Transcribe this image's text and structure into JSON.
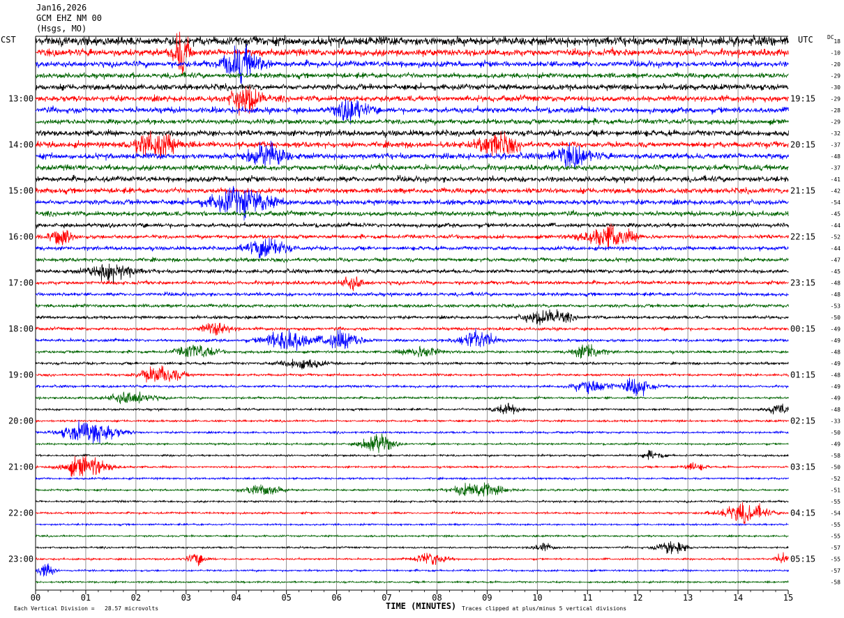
{
  "chart_data": {
    "type": "line",
    "title_lines": [
      "Jan16,2026",
      "GCM EHZ NM 00",
      "(Hsgs, MO)"
    ],
    "left_axis_label": "CST",
    "right_axis_label": "UTC",
    "dc_label": "DC",
    "xlabel": "TIME (MINUTES)",
    "x_ticks": [
      "00",
      "01",
      "02",
      "03",
      "04",
      "05",
      "06",
      "07",
      "08",
      "09",
      "10",
      "11",
      "12",
      "13",
      "14",
      "15"
    ],
    "xlim": [
      0,
      15
    ],
    "trace_colors": [
      "#000000",
      "#ff0000",
      "#0000ff",
      "#006400"
    ],
    "trace_count": 48,
    "traces_per_hour": 4,
    "left_hour_labels": [
      "13:00",
      "14:00",
      "15:00",
      "16:00",
      "17:00",
      "18:00",
      "19:00",
      "20:00",
      "21:00",
      "22:00",
      "23:00"
    ],
    "left_hour_trace_index": [
      5,
      9,
      13,
      17,
      21,
      25,
      29,
      33,
      37,
      41,
      45
    ],
    "right_hour_labels": [
      "19:15",
      "20:15",
      "21:15",
      "22:15",
      "23:15",
      "00:15",
      "01:15",
      "02:15",
      "03:15",
      "04:15",
      "05:15"
    ],
    "dc_values": [
      "18",
      "-10",
      "-20",
      "-29",
      "-30",
      "-29",
      "-28",
      "-29",
      "-32",
      "-37",
      "-48",
      "-37",
      "-41",
      "-42",
      "-54",
      "-45",
      "-44",
      "-52",
      "-44",
      "-47",
      "-45",
      "-48",
      "-48",
      "-53",
      "-50",
      "-49",
      "-49",
      "-48",
      "-49",
      "-48",
      "-49",
      "-49",
      "-48",
      "-33",
      "-50",
      "-49",
      "-58",
      "-50",
      "-52",
      "-51",
      "-55",
      "-54",
      "-55",
      "-55",
      "-57",
      "-55",
      "-57",
      "-58"
    ],
    "trace_amplitude": [
      7.0,
      5.4,
      4.6,
      4.1,
      4.6,
      4.6,
      4.5,
      4.0,
      4.6,
      4.6,
      4.5,
      4.4,
      4.3,
      4.2,
      4.0,
      3.8,
      3.3,
      3.0,
      3.0,
      3.0,
      3.0,
      2.8,
      2.7,
      2.6,
      2.4,
      2.3,
      2.2,
      2.0,
      2.0,
      1.8,
      1.8,
      1.7,
      1.6,
      1.6,
      1.6,
      1.5,
      1.5,
      1.5,
      1.5,
      1.5,
      1.5,
      1.5,
      1.4,
      1.4,
      1.4,
      1.4,
      1.4,
      1.4
    ],
    "events": [
      {
        "trace": 1,
        "minute": 2.9,
        "amplitude": 40,
        "width_min": 0.2
      },
      {
        "trace": 2,
        "minute": 4.1,
        "amplitude": 25,
        "width_min": 0.5
      },
      {
        "trace": 5,
        "minute": 4.2,
        "amplitude": 22,
        "width_min": 0.4
      },
      {
        "trace": 6,
        "minute": 6.3,
        "amplitude": 20,
        "width_min": 0.4
      },
      {
        "trace": 9,
        "minute": 2.4,
        "amplitude": 18,
        "width_min": 0.6
      },
      {
        "trace": 9,
        "minute": 9.2,
        "amplitude": 18,
        "width_min": 0.5
      },
      {
        "trace": 10,
        "minute": 4.6,
        "amplitude": 20,
        "width_min": 0.5
      },
      {
        "trace": 10,
        "minute": 10.7,
        "amplitude": 16,
        "width_min": 0.5
      },
      {
        "trace": 14,
        "minute": 4.1,
        "amplitude": 22,
        "width_min": 0.8
      },
      {
        "trace": 17,
        "minute": 0.5,
        "amplitude": 14,
        "width_min": 0.3
      },
      {
        "trace": 17,
        "minute": 11.4,
        "amplitude": 16,
        "width_min": 0.7
      },
      {
        "trace": 18,
        "minute": 4.6,
        "amplitude": 18,
        "width_min": 0.5
      },
      {
        "trace": 20,
        "minute": 1.5,
        "amplitude": 14,
        "width_min": 0.6
      },
      {
        "trace": 21,
        "minute": 6.3,
        "amplitude": 10,
        "width_min": 0.3
      },
      {
        "trace": 24,
        "minute": 10.2,
        "amplitude": 12,
        "width_min": 0.6
      },
      {
        "trace": 25,
        "minute": 3.6,
        "amplitude": 10,
        "width_min": 0.4
      },
      {
        "trace": 26,
        "minute": 5.0,
        "amplitude": 18,
        "width_min": 0.6
      },
      {
        "trace": 26,
        "minute": 6.1,
        "amplitude": 16,
        "width_min": 0.5
      },
      {
        "trace": 26,
        "minute": 8.8,
        "amplitude": 16,
        "width_min": 0.5
      },
      {
        "trace": 27,
        "minute": 3.2,
        "amplitude": 12,
        "width_min": 0.5
      },
      {
        "trace": 27,
        "minute": 7.7,
        "amplitude": 10,
        "width_min": 0.5
      },
      {
        "trace": 27,
        "minute": 11.0,
        "amplitude": 12,
        "width_min": 0.4
      },
      {
        "trace": 28,
        "minute": 5.3,
        "amplitude": 10,
        "width_min": 0.5
      },
      {
        "trace": 29,
        "minute": 2.5,
        "amplitude": 14,
        "width_min": 0.6
      },
      {
        "trace": 30,
        "minute": 11.1,
        "amplitude": 12,
        "width_min": 0.5
      },
      {
        "trace": 30,
        "minute": 12.0,
        "amplitude": 14,
        "width_min": 0.4
      },
      {
        "trace": 31,
        "minute": 1.9,
        "amplitude": 10,
        "width_min": 0.6
      },
      {
        "trace": 32,
        "minute": 9.4,
        "amplitude": 8,
        "width_min": 0.4
      },
      {
        "trace": 32,
        "minute": 14.8,
        "amplitude": 8,
        "width_min": 0.3
      },
      {
        "trace": 34,
        "minute": 1.1,
        "amplitude": 20,
        "width_min": 0.7
      },
      {
        "trace": 35,
        "minute": 6.8,
        "amplitude": 18,
        "width_min": 0.4
      },
      {
        "trace": 36,
        "minute": 12.3,
        "amplitude": 6,
        "width_min": 0.3
      },
      {
        "trace": 37,
        "minute": 1.0,
        "amplitude": 18,
        "width_min": 0.6
      },
      {
        "trace": 37,
        "minute": 13.1,
        "amplitude": 6,
        "width_min": 0.3
      },
      {
        "trace": 39,
        "minute": 4.5,
        "amplitude": 10,
        "width_min": 0.5
      },
      {
        "trace": 39,
        "minute": 8.8,
        "amplitude": 14,
        "width_min": 0.6
      },
      {
        "trace": 41,
        "minute": 14.1,
        "amplitude": 16,
        "width_min": 0.6
      },
      {
        "trace": 44,
        "minute": 10.1,
        "amplitude": 6,
        "width_min": 0.3
      },
      {
        "trace": 44,
        "minute": 12.7,
        "amplitude": 12,
        "width_min": 0.4
      },
      {
        "trace": 45,
        "minute": 3.2,
        "amplitude": 8,
        "width_min": 0.3
      },
      {
        "trace": 45,
        "minute": 7.9,
        "amplitude": 12,
        "width_min": 0.4
      },
      {
        "trace": 45,
        "minute": 14.9,
        "amplitude": 10,
        "width_min": 0.2
      },
      {
        "trace": 46,
        "minute": 0.2,
        "amplitude": 14,
        "width_min": 0.2
      }
    ],
    "grid": "vertical minute lines",
    "bottom_notes": [
      "Each Vertical Division =   28.57 microvolts",
      "Traces clipped at plus/minus 5 vertical divisions"
    ]
  }
}
